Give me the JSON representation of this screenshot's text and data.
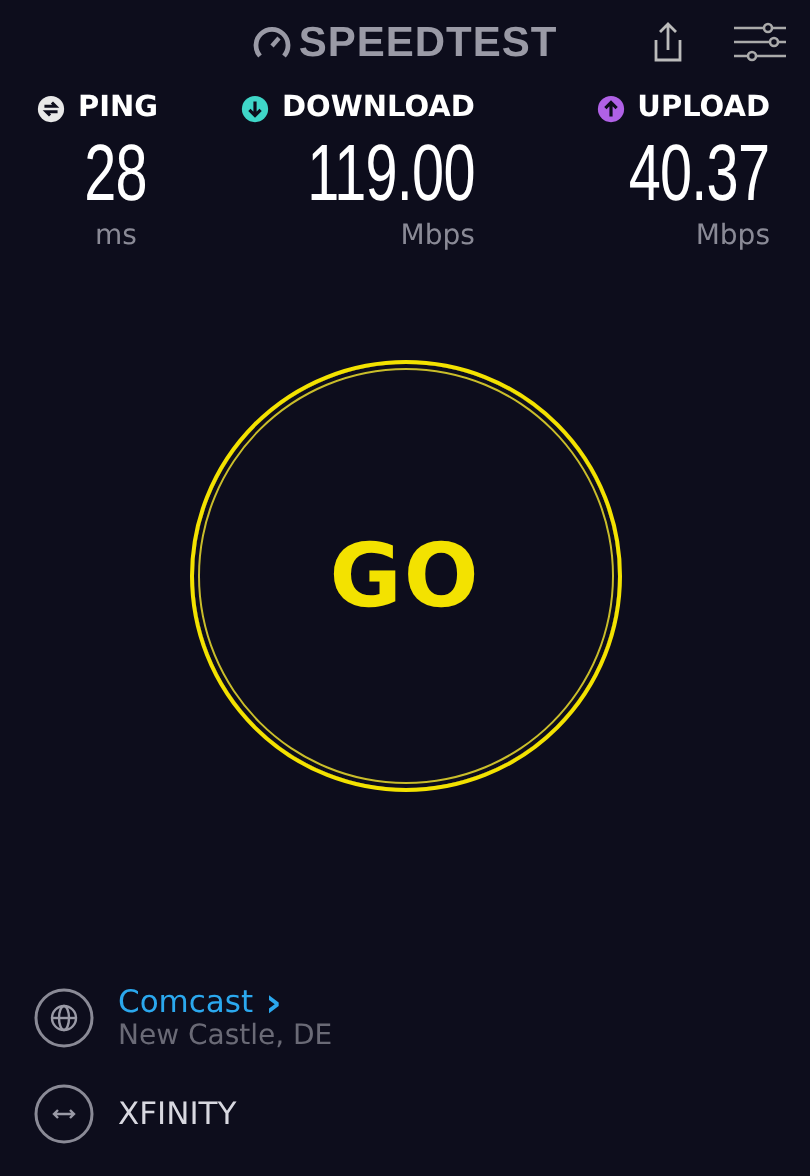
{
  "header": {
    "logo": "SPEEDTEST"
  },
  "metrics": [
    {
      "label": "PING",
      "value": "28",
      "unit": "ms",
      "color": "#e8e8e8"
    },
    {
      "label": "DOWNLOAD",
      "value": "119.00",
      "unit": "Mbps",
      "color": "#3fd6c8"
    },
    {
      "label": "UPLOAD",
      "value": "40.37",
      "unit": "Mbps",
      "color": "#b061e6"
    }
  ],
  "go_button": {
    "label": "GO"
  },
  "server": {
    "name": "Comcast",
    "chevron": "›",
    "location": "New Castle, DE"
  },
  "provider": {
    "name": "XFINITY"
  }
}
